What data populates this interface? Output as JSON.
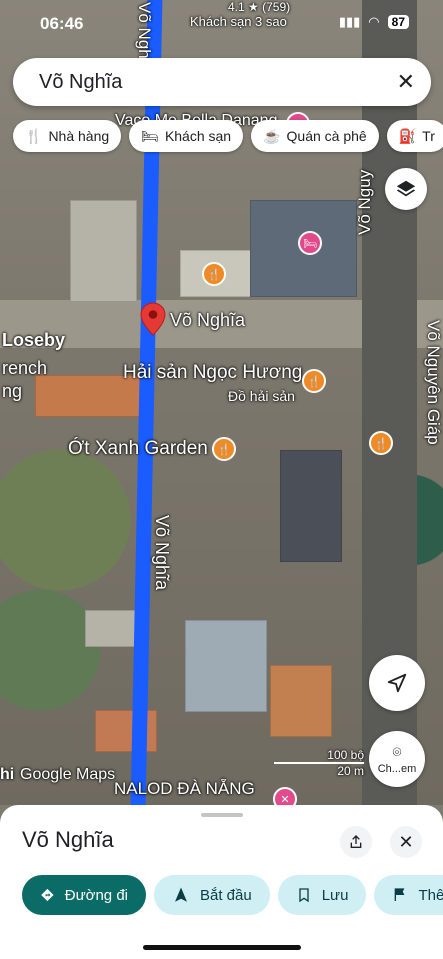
{
  "status_bar": {
    "time": "06:46",
    "battery": "87",
    "rating_text": "4.1 ★ (759)",
    "hotel_label": "Khách sạn 3 sao"
  },
  "search": {
    "value": "Võ Nghĩa"
  },
  "chips": [
    {
      "label": "Nhà hàng",
      "icon": "fork-knife-icon"
    },
    {
      "label": "Khách sạn",
      "icon": "bed-icon"
    },
    {
      "label": "Quán cà phê",
      "icon": "coffee-icon"
    },
    {
      "label": "Tr",
      "icon": "gas-icon"
    }
  ],
  "map": {
    "pin_label": "Võ Nghĩa",
    "street_main": "Võ Nghĩa",
    "street_right": "Võ Nguyên Giáp",
    "street_right_top": "Võ Nguy",
    "top_label": "Vaco Me Bella Danang",
    "left_label_1": "Loseby",
    "left_label_2": "rench",
    "left_label_3": "ng",
    "poi_1": "Hải sản Ngọc Hương",
    "poi_1_sub": "Đồ hải sản",
    "poi_2": "Ớt Xanh Garden",
    "bottom_label": "NALOD ĐÀ NẴNG",
    "attribution_prefix": "hi",
    "attribution": "Google Maps",
    "scale_ft": "100 bộ",
    "scale_m": "20 m",
    "chrome_btn": "Ch...em"
  },
  "sheet": {
    "title": "Võ Nghĩa",
    "actions": [
      {
        "label": "Đường đi",
        "icon": "directions-icon"
      },
      {
        "label": "Bắt đầu",
        "icon": "navigation-arrow-icon"
      },
      {
        "label": "Lưu",
        "icon": "bookmark-icon"
      },
      {
        "label": "Thê",
        "icon": "flag-icon"
      }
    ]
  },
  "colors": {
    "route": "#1a5cff",
    "primary": "#0b6b66",
    "secondary": "#cfeff5",
    "poi": "#f08a24",
    "pin": "#e53935"
  }
}
